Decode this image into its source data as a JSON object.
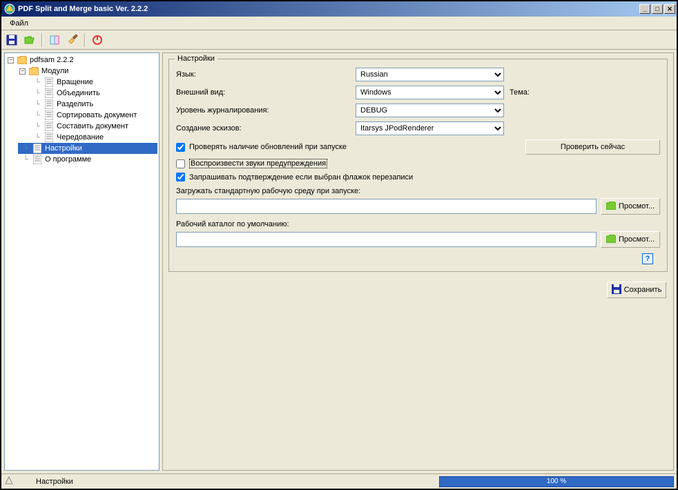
{
  "window": {
    "title": "PDF Split and Merge basic Ver. 2.2.2"
  },
  "menubar": {
    "file": "Файл"
  },
  "tree": {
    "root": "pdfsam 2.2.2",
    "modules_label": "Модули",
    "items": [
      "Вращение",
      "Объединить",
      "Разделить",
      "Сортировать документ",
      "Составить документ",
      "Чередование"
    ],
    "settings": "Настройки",
    "about": "О программе"
  },
  "settings": {
    "legend": "Настройки",
    "language_label": "Язык:",
    "language_value": "Russian",
    "look_label": "Внешний вид:",
    "look_value": "Windows",
    "theme_label": "Тема:",
    "log_label": "Уровень журналирования:",
    "log_value": "DEBUG",
    "thumbnails_label": "Создание эскизов:",
    "thumbnails_value": "Itarsys JPodRenderer",
    "check_updates_label": "Проверять наличие обновлений при запуске",
    "check_now": "Проверить сейчас",
    "play_sounds_label": "Воспроизвести звуки предупреждения",
    "ask_overwrite_label": "Запрашивать подтверждение если выбран флажок перезаписи",
    "load_env_label": "Загружать стандартную рабочую среду при запуске:",
    "default_dir_label": "Рабочий каталог по умолчанию:",
    "browse": "Просмот...",
    "save": "Сохранить"
  },
  "status": {
    "text": "Настройки",
    "progress": "100 %"
  }
}
